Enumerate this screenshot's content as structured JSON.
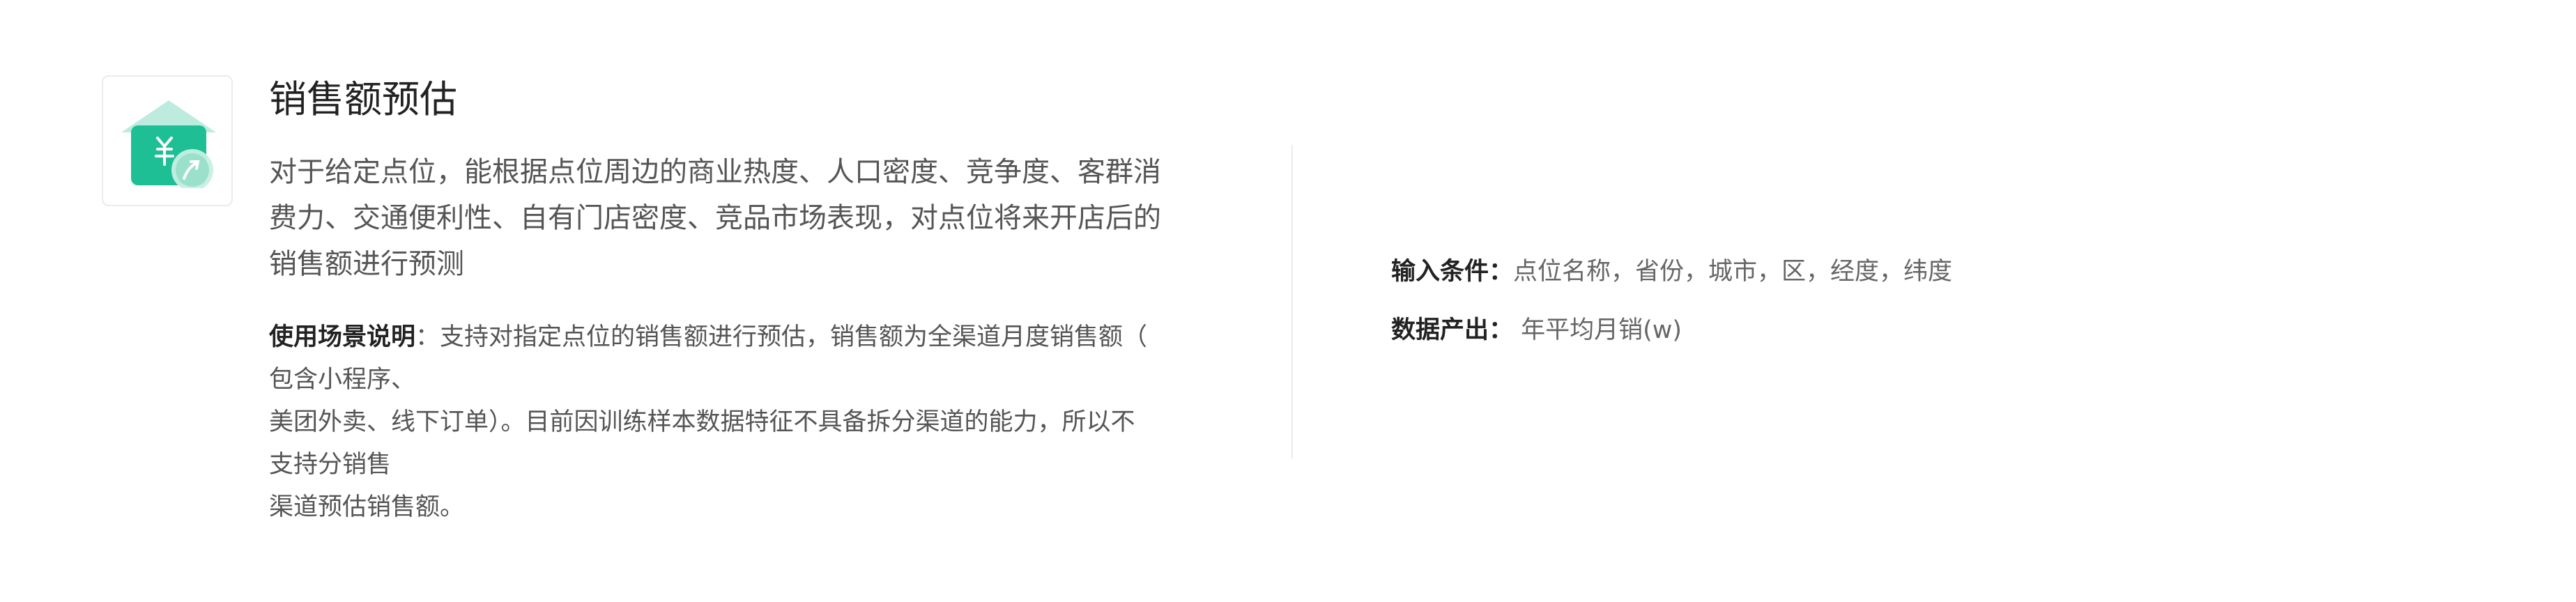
{
  "header": {
    "title": "销售额预估",
    "icon": "house-yen-growth-icon"
  },
  "description": {
    "lines": [
      "对于给定点位，能根据点位周边的商业热度、人口密度、竞争度、客群消",
      "费力、交通便利性、自有门店密度、竞品市场表现，对点位将来开店后的",
      "销售额进行预测"
    ]
  },
  "usage": {
    "label": "使用场景说明",
    "lines": [
      "：支持对指定点位的销售额进行预估，销售额为全渠道月度销售额（",
      "包含小程序、",
      "美团外卖、线下订单）。目前因训练样本数据特征不具备拆分渠道的能力，所以不",
      "支持分销售",
      "渠道预估销售额。"
    ]
  },
  "specs": {
    "input_label": "输入条件：",
    "input_value": "点位名称，省份，城市，区，经度，纬度",
    "output_label": "数据产出：",
    "output_value": " 年平均月销(w)"
  },
  "colors": {
    "accent": "#1fbf95",
    "accent_light": "#b9eadb",
    "roof": "#a8e3d2"
  }
}
